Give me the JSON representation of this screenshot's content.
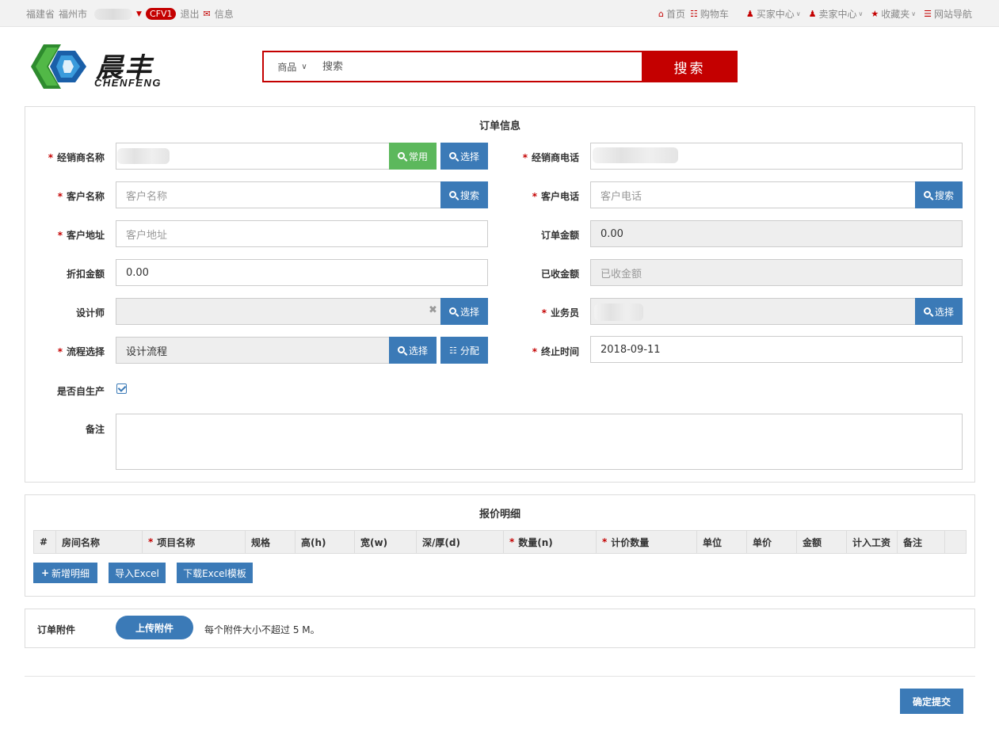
{
  "topbar": {
    "province": "福建省",
    "city": "福州市",
    "badge": "CFV1",
    "logout": "退出",
    "message": "信息",
    "right_links": [
      {
        "icon": "home-icon",
        "label": "首页",
        "has_dropdown": false
      },
      {
        "icon": "cart-icon",
        "label": "购物车",
        "has_dropdown": false
      },
      {
        "icon": "user-icon",
        "label": "买家中心",
        "has_dropdown": true
      },
      {
        "icon": "user-icon",
        "label": "卖家中心",
        "has_dropdown": true
      },
      {
        "icon": "star-icon",
        "label": "收藏夹",
        "has_dropdown": true
      },
      {
        "icon": "list-icon",
        "label": "网站导航",
        "has_dropdown": false
      }
    ],
    "accent": "#c40000"
  },
  "logo": {
    "cn": "晨丰",
    "en": "CHENFENG"
  },
  "search": {
    "category": "商品",
    "placeholder": "搜索",
    "button": "搜索"
  },
  "order": {
    "title": "订单信息",
    "dealer_name_label": "经销商名称",
    "btn_common": "常用",
    "btn_select": "选择",
    "dealer_phone_label": "经销商电话",
    "customer_name_label": "客户名称",
    "customer_name_placeholder": "客户名称",
    "btn_search": "搜索",
    "customer_phone_label": "客户电话",
    "customer_phone_placeholder": "客户电话",
    "customer_address_label": "客户地址",
    "customer_address_placeholder": "客户地址",
    "order_amount_label": "订单金额",
    "order_amount_value": "0.00",
    "discount_label": "折扣金额",
    "discount_value": "0.00",
    "received_label": "已收金额",
    "received_placeholder": "已收金额",
    "designer_label": "设计师",
    "salesman_label": "业务员",
    "process_label": "流程选择",
    "process_value": "设计流程",
    "btn_assign": "分配",
    "end_time_label": "终止时间",
    "end_time_value": "2018-09-11",
    "self_produce_label": "是否自生产",
    "self_produce_checked": true,
    "remark_label": "备注"
  },
  "quote": {
    "title": "报价明细",
    "columns": [
      {
        "label": "#",
        "required": false
      },
      {
        "label": "房间名称",
        "required": false
      },
      {
        "label": "项目名称",
        "required": true
      },
      {
        "label": "规格",
        "required": false
      },
      {
        "label": "高(h)",
        "required": false
      },
      {
        "label": "宽(w)",
        "required": false
      },
      {
        "label": "深/厚(d)",
        "required": false
      },
      {
        "label": "数量(n)",
        "required": true
      },
      {
        "label": "计价数量",
        "required": true
      },
      {
        "label": "单位",
        "required": false
      },
      {
        "label": "单价",
        "required": false
      },
      {
        "label": "金额",
        "required": false
      },
      {
        "label": "计入工资",
        "required": false
      },
      {
        "label": "备注",
        "required": false
      }
    ],
    "btn_add": "新增明细",
    "btn_import": "导入Excel",
    "btn_download": "下载Excel模板"
  },
  "attachment": {
    "label": "订单附件",
    "btn_upload": "上传附件",
    "hint": "每个附件大小不超过 5 M。"
  },
  "submit_label": "确定提交"
}
